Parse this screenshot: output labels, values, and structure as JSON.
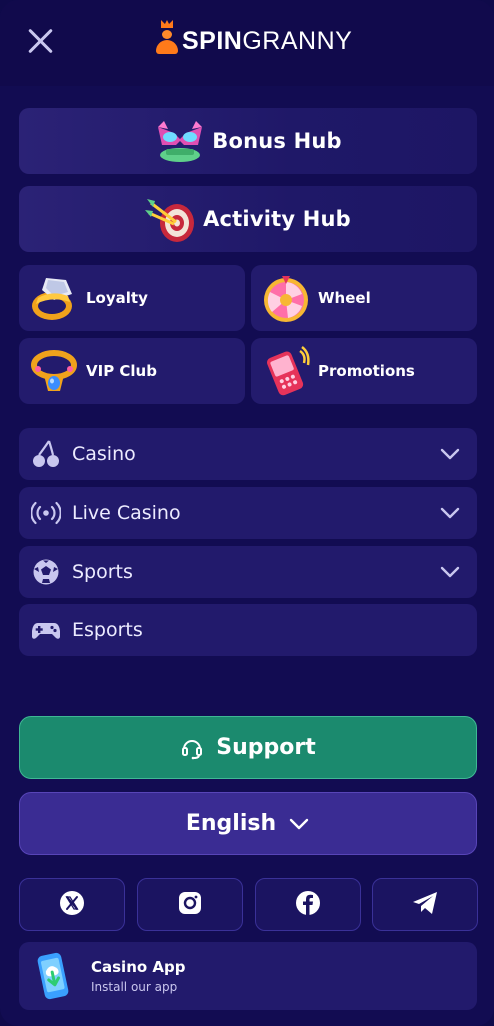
{
  "brand": {
    "spin": "SPIN",
    "granny": "GRANNY"
  },
  "hubs": [
    {
      "label": "Bonus Hub",
      "icon": "bonus-mask-icon"
    },
    {
      "label": "Activity Hub",
      "icon": "dart-target-icon"
    }
  ],
  "tiles": [
    {
      "label": "Loyalty",
      "icon": "ring-icon"
    },
    {
      "label": "Wheel",
      "icon": "wheel-icon"
    },
    {
      "label": "VIP Club",
      "icon": "necklace-icon"
    },
    {
      "label": "Promotions",
      "icon": "phone-icon"
    }
  ],
  "nav": [
    {
      "label": "Casino",
      "icon": "cherry-icon",
      "expandable": true
    },
    {
      "label": "Live Casino",
      "icon": "broadcast-icon",
      "expandable": true
    },
    {
      "label": "Sports",
      "icon": "soccer-ball-icon",
      "expandable": true
    },
    {
      "label": "Esports",
      "icon": "gamepad-icon",
      "expandable": false
    }
  ],
  "support": {
    "label": "Support",
    "icon": "headset-icon"
  },
  "language": {
    "label": "English"
  },
  "social": [
    {
      "icon": "x-icon"
    },
    {
      "icon": "instagram-icon"
    },
    {
      "icon": "facebook-icon"
    },
    {
      "icon": "telegram-icon"
    }
  ],
  "app": {
    "title": "Casino App",
    "subtitle": "Install our app",
    "icon": "phone-download-icon"
  },
  "colors": {
    "background": "#120c52",
    "card": "#221a6c",
    "support": "#1b8a6e",
    "language": "#3a2c93",
    "brand_orange": "#ff7a1a"
  }
}
